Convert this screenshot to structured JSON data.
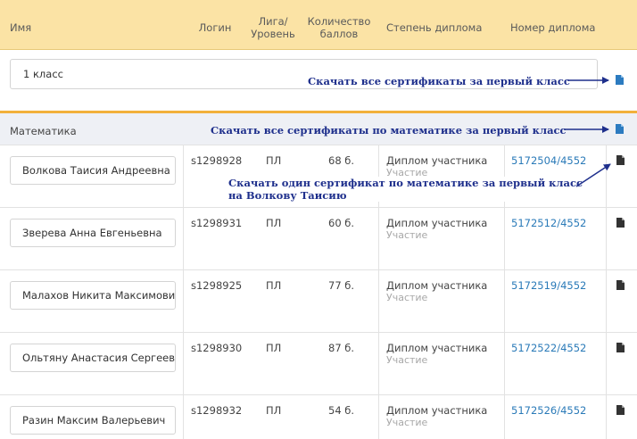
{
  "header": {
    "name": "Имя",
    "login": "Логин",
    "league_line1": "Лига/",
    "league_line2": "Уровень",
    "score_line1": "Количество",
    "score_line2": "баллов",
    "degree": "Степень диплома",
    "number": "Номер диплома"
  },
  "class_group": {
    "label": "1 класс"
  },
  "subject": {
    "label": "Математика"
  },
  "annotations": {
    "download_all_class": "Скачать все сертификаты за первый класс",
    "download_all_subject": "Скачать все сертификаты по математике за первый класс",
    "download_one_line1": "Скачать один сертификат по математике за первый класс",
    "download_one_line2": "на Волкову  Таисию"
  },
  "rows": [
    {
      "name": "Волкова Таисия Андреевна",
      "login": "s1298928",
      "league": "ПЛ",
      "score": "68 б.",
      "degree": "Диплом участника",
      "degree_sub": "Участие",
      "number": "5172504/4552"
    },
    {
      "name": "Зверева Анна Евгеньевна",
      "login": "s1298931",
      "league": "ПЛ",
      "score": "60 б.",
      "degree": "Диплом участника",
      "degree_sub": "Участие",
      "number": "5172512/4552"
    },
    {
      "name": "Малахов Никита Максимови",
      "login": "s1298925",
      "league": "ПЛ",
      "score": "77 б.",
      "degree": "Диплом участника",
      "degree_sub": "Участие",
      "number": "5172519/4552"
    },
    {
      "name": "Ольтяну Анастасия Сергееви",
      "login": "s1298930",
      "league": "ПЛ",
      "score": "87 б.",
      "degree": "Диплом участника",
      "degree_sub": "Участие",
      "number": "5172522/4552"
    },
    {
      "name": "Разин Максим Валерьевич",
      "login": "s1298932",
      "league": "ПЛ",
      "score": "54 б.",
      "degree": "Диплом участника",
      "degree_sub": "Участие",
      "number": "5172526/4552"
    }
  ],
  "colors": {
    "header_bg": "#fbe3a5",
    "accent": "#f2b03b",
    "link": "#2a7ab8",
    "callout": "#1e2f8c",
    "blue_icon": "#2c7bc0",
    "dark_icon": "#333333"
  },
  "icons": {
    "download": "file-icon"
  }
}
